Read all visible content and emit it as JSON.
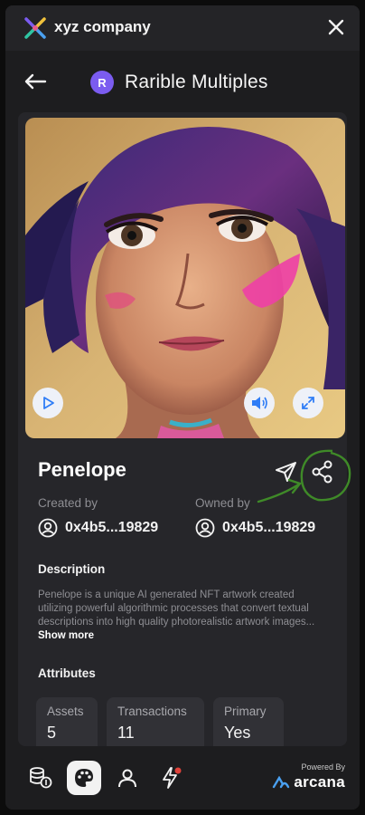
{
  "header": {
    "brand": "xyz company"
  },
  "subheader": {
    "title": "Rarible Multiples",
    "badge_letter": "R"
  },
  "nft": {
    "name": "Penelope",
    "created_by_label": "Created by",
    "created_by": "0x4b5...19829",
    "owned_by_label": "Owned by",
    "owned_by": "0x4b5...19829",
    "description_title": "Description",
    "description": "Penelope is a unique AI generated NFT artwork created utilizing powerful algorithmic processes that convert textual descriptions into high quality photorealistic artwork images...",
    "show_more": " Show more",
    "attributes_title": "Attributes",
    "attributes": [
      {
        "key": "Assets",
        "value": "5"
      },
      {
        "key": "Transactions",
        "value": "11"
      },
      {
        "key": "Primary",
        "value": "Yes"
      }
    ]
  },
  "footer": {
    "powered_by": "Powered By",
    "brand": "arcana"
  },
  "colors": {
    "accent": "#7b5cf0",
    "annotation": "#3f8a28",
    "notification": "#e0423a"
  },
  "icons": [
    "logo-icon",
    "close-icon",
    "back-arrow-icon",
    "play-icon",
    "speaker-icon",
    "expand-icon",
    "send-icon",
    "share-icon",
    "user-circle-icon",
    "coins-icon",
    "palette-icon",
    "profile-icon",
    "lightning-icon",
    "arcana-logo-icon"
  ]
}
